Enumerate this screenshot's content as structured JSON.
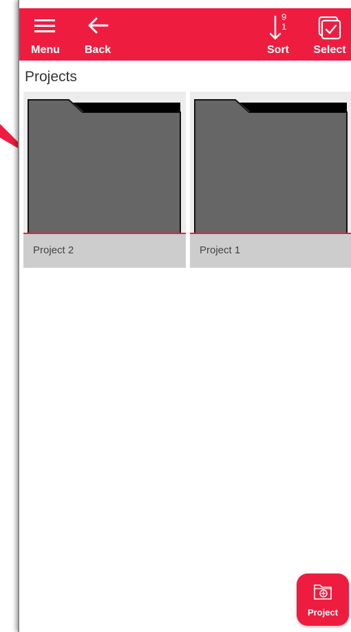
{
  "toolbar": {
    "menu_label": "Menu",
    "back_label": "Back",
    "sort_label": "Sort",
    "sort_top_digit": "9",
    "sort_bottom_digit": "1",
    "select_label": "Select"
  },
  "page": {
    "title": "Projects"
  },
  "projects": [
    {
      "name": "Project 2"
    },
    {
      "name": "Project 1"
    }
  ],
  "fab": {
    "label": "Project"
  },
  "colors": {
    "accent": "#ee1d3f",
    "folder": "#666666",
    "card_label_bg": "#cdcdcd"
  },
  "icons": {
    "menu": "hamburger-icon",
    "back": "arrow-left-icon",
    "sort": "sort-arrow-icon",
    "select": "checkbox-stack-icon",
    "fab": "add-folder-icon"
  }
}
